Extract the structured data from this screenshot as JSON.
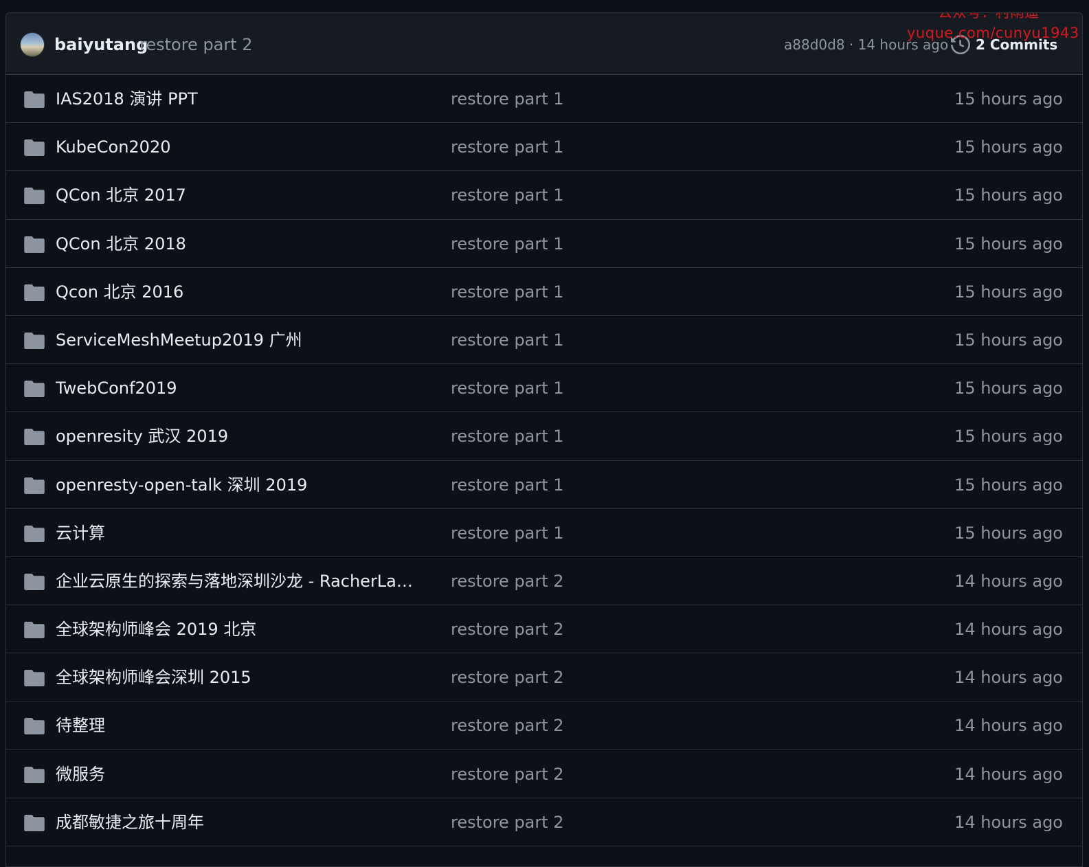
{
  "header": {
    "author": "baiyutang",
    "commit_message": "restore part 2",
    "sha_and_time": "a88d0d8 · 14 hours ago",
    "commits_label": "2 Commits"
  },
  "watermark": {
    "line1": "公众号：村雨遥",
    "line2": "yuque.com/cunyu1943"
  },
  "files": [
    {
      "name": "IAS2018 演讲 PPT",
      "message": "restore part 1",
      "age": "15 hours ago",
      "type": "folder"
    },
    {
      "name": "KubeCon2020",
      "message": "restore part 1",
      "age": "15 hours ago",
      "type": "folder"
    },
    {
      "name": "QCon 北京 2017",
      "message": "restore part 1",
      "age": "15 hours ago",
      "type": "folder"
    },
    {
      "name": "QCon 北京 2018",
      "message": "restore part 1",
      "age": "15 hours ago",
      "type": "folder"
    },
    {
      "name": "Qcon 北京 2016",
      "message": "restore part 1",
      "age": "15 hours ago",
      "type": "folder"
    },
    {
      "name": "ServiceMeshMeetup2019 广州",
      "message": "restore part 1",
      "age": "15 hours ago",
      "type": "folder"
    },
    {
      "name": "TwebConf2019",
      "message": "restore part 1",
      "age": "15 hours ago",
      "type": "folder"
    },
    {
      "name": "openresity 武汉 2019",
      "message": "restore part 1",
      "age": "15 hours ago",
      "type": "folder"
    },
    {
      "name": "openresty-open-talk 深圳 2019",
      "message": "restore part 1",
      "age": "15 hours ago",
      "type": "folder"
    },
    {
      "name": "云计算",
      "message": "restore part 1",
      "age": "15 hours ago",
      "type": "folder"
    },
    {
      "name": "企业云原生的探索与落地深圳沙龙 - RacherLab...",
      "message": "restore part 2",
      "age": "14 hours ago",
      "type": "folder"
    },
    {
      "name": "全球架构师峰会 2019 北京",
      "message": "restore part 2",
      "age": "14 hours ago",
      "type": "folder"
    },
    {
      "name": "全球架构师峰会深圳 2015",
      "message": "restore part 2",
      "age": "14 hours ago",
      "type": "folder"
    },
    {
      "name": "待整理",
      "message": "restore part 2",
      "age": "14 hours ago",
      "type": "folder"
    },
    {
      "name": "微服务",
      "message": "restore part 2",
      "age": "14 hours ago",
      "type": "folder"
    },
    {
      "name": "成都敏捷之旅十周年",
      "message": "restore part 2",
      "age": "14 hours ago",
      "type": "folder"
    }
  ],
  "colors": {
    "background": "#0d1117",
    "header_background": "#161b22",
    "border": "#30363d",
    "text": "#e6edf3",
    "muted": "#8d96a0",
    "folder_icon": "#8d96a0",
    "watermark": "#e4181c"
  }
}
